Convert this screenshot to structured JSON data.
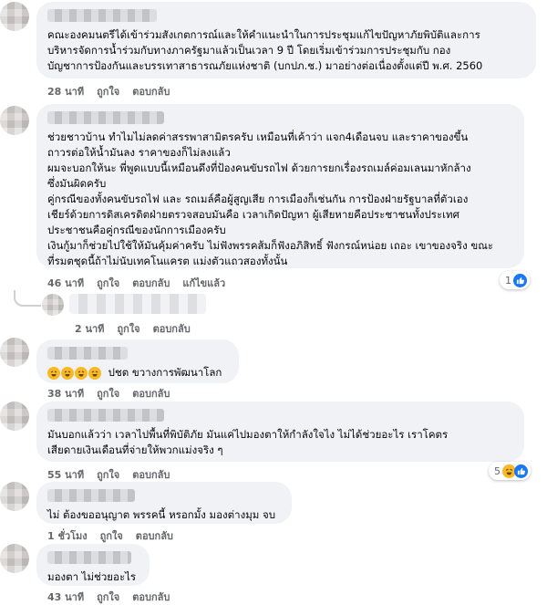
{
  "comments": [
    {
      "lines": [
        "คณะองคมนตรีได้เข้าร่วมสังเกตการณ์และให้คำแนะนำในการประชุมแก้ไขปัญหาภัยพิบัติและการ",
        "บริหารจัดการน้ำร่วมกับทางภาครัฐมาแล้วเป็นเวลา 9 ปี โดยเริ่มเข้าร่วมการประชุมกับ กอง",
        "บัญชาการป้องกันและบรรเทาสาธารณภัยแห่งชาติ (บกปภ.ช.) มาอย่างต่อเนื่องตั้งแต่ปี พ.ศ. 2560"
      ],
      "time": "28 นาที",
      "like": "ถูกใจ",
      "reply": "ตอบกลับ"
    },
    {
      "lines": [
        "ช่วยชาวบ้าน ทำไมไม่ลดค่าสรรพาสามิตรครับ เหมือนที่เค้าว่า แจก4เดือนจบ และราคาของขึ้น",
        "ถาวรต่อให้น้ำมันลง ราคาของก็ไม่ลงแล้ว",
        "ผมจะบอกให้นะ พี่พูดแบบนี้เหมือนดึงที่ป้องคนขับรถไฟ ด้วยการยกเรื่องรถเมล์ค่อมเลนมาหักล้าง",
        "ซึ่งมันผิดครับ",
        "คู่กรณีของทั้งคนขับรถไฟ และ รถเมล์คือผู้สูญเสีย การเมืองก็เช่นกัน การป้องฝ่ายรัฐบาลที่ตัวเอง",
        "เชียร์ด้วยการดิสเครดิตฝ่ายตรวจสอบมันคือ เวลาเกิดปัญหา ผู้เสียหายคือประชาชนทั้งประเทศ",
        "ประชาชนคือคู่กรณีของนักการเมืองครับ",
        "เงินกู้มาก็ช่วยไปใช้ให้มันคุ้มค่าครับ ไม่ฟังพรรคส้มก็ฟังอภิสิทธิ์ ฟังกรณ์หน่อย เถอะ เขาของจริง ขณะ",
        "ที่รมตชุดนี้ถ้าไม่นับเทคโนแครต แม่งตัวแถวสองทั้งนั้น"
      ],
      "time": "46 นาที",
      "like": "ถูกใจ",
      "reply": "ตอบกลับ",
      "edited": "แก้ไขแล้ว",
      "reaction_count": "1"
    },
    {
      "time": "2 นาที",
      "like": "ถูกใจ",
      "reply": "ตอบกลับ"
    },
    {
      "text": "ปชต ขวางการพัฒนาโลก",
      "time": "38 นาที",
      "like": "ถูกใจ",
      "reply": "ตอบกลับ"
    },
    {
      "lines": [
        "มันบอกแล้วว่า เวลาไปพื้นที่พิบัติภัย มันแค่ไปมองตาให้กำลังใจไง ไม่ได้ช่วยอะไร เราโคตร",
        "เสียดายเงินเดือนที่จ่ายให้พวกแม่งจริง ๆ"
      ],
      "time": "55 นาที",
      "like": "ถูกใจ",
      "reply": "ตอบกลับ",
      "reaction_count": "5"
    },
    {
      "text": "ไม่ ต้องขออนุญาต พรรคนี้ หรอกมั้ง มองต่างมุม จบ",
      "time": "1 ชั่วโมง",
      "like": "ถูกใจ",
      "reply": "ตอบกลับ"
    },
    {
      "text": "มองตา ไม่ช่วยอะไร",
      "time": "43 นาที",
      "like": "ถูกใจ",
      "reply": "ตอบกลับ"
    }
  ],
  "colors": {
    "bubble": "#f0f2f5",
    "meta": "#65676b",
    "like_blue": "#1877f2",
    "haha_yellow": "#f7b928"
  },
  "icons": [
    "like-reaction-icon",
    "haha-reaction-icon",
    "laughing-emoji-icon"
  ]
}
